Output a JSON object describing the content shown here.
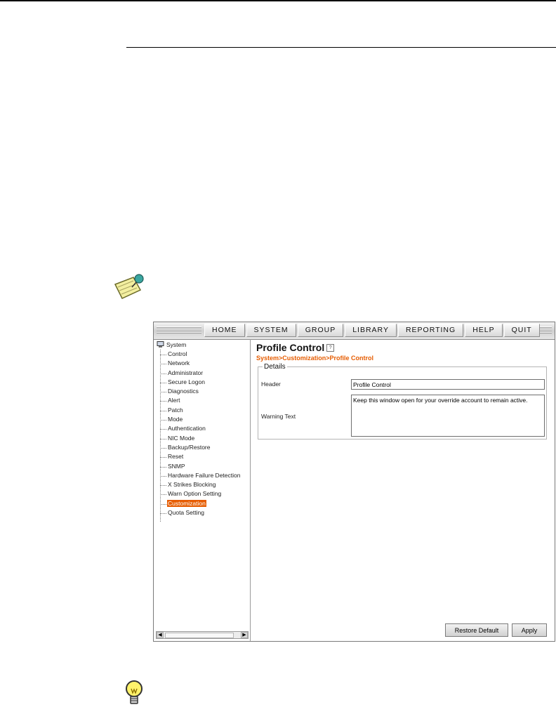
{
  "menu": [
    "HOME",
    "SYSTEM",
    "GROUP",
    "LIBRARY",
    "REPORTING",
    "HELP",
    "QUIT"
  ],
  "tree": {
    "root": "System",
    "items": [
      "Control",
      "Network",
      "Administrator",
      "Secure Logon",
      "Diagnostics",
      "Alert",
      "Patch",
      "Mode",
      "Authentication",
      "NIC Mode",
      "Backup/Restore",
      "Reset",
      "SNMP",
      "Hardware Failure Detection",
      "X Strikes Blocking",
      "Warn Option Setting",
      "Customization",
      "Quota Setting"
    ],
    "selected": "Customization"
  },
  "page": {
    "title": "Profile Control",
    "breadcrumb": "System>Customization>Profile Control"
  },
  "details": {
    "legend": "Details",
    "header_label": "Header",
    "header_value": "Profile Control",
    "warning_label": "Warning Text",
    "warning_value": "Keep this window open for your override account to remain active."
  },
  "buttons": {
    "restore_default": "Restore Default",
    "apply": "Apply"
  },
  "icons": {
    "note": "note-pin-icon",
    "tip": "lightbulb-icon",
    "help": "help-icon",
    "system": "computer-icon"
  },
  "colors": {
    "accent": "#e65c00"
  }
}
